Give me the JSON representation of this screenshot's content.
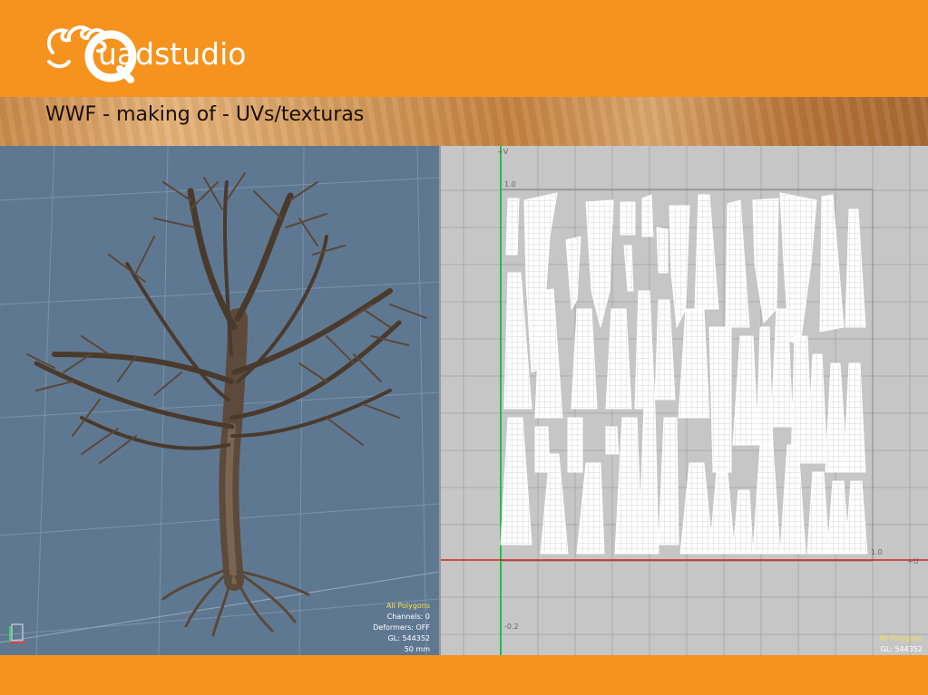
{
  "header": {
    "brand": "uadstudio"
  },
  "title": "WWF - making of - UVs/texturas",
  "viewport_3d": {
    "info": {
      "selection": "All Polygons",
      "channels": "Channels: 0",
      "deformers": "Deformers: OFF",
      "gl": "GL: 544352",
      "units": "50 mm"
    }
  },
  "uv_editor": {
    "axis": {
      "v_label": "+V",
      "u_label": "+U"
    },
    "ticks": {
      "v_top": "1.0",
      "u_right": "1.0",
      "v_bottom": "-0.2"
    },
    "info": {
      "selection": "All Polygons",
      "gl": "GL: 544352"
    }
  },
  "colors": {
    "orange": "#f6921e",
    "viewport_bg": "#5f7892",
    "uv_bg": "#c6c6c6",
    "v_axis": "#22c046",
    "u_axis": "#d02020"
  }
}
